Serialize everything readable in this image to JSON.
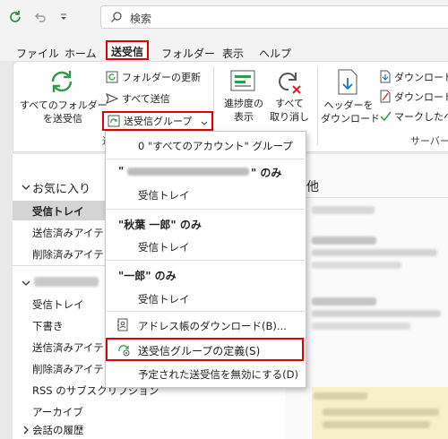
{
  "titlebar": {
    "search_placeholder": "検索"
  },
  "menu": {
    "tabs": [
      "ファイル",
      "ホーム",
      "送受信",
      "フォルダー",
      "表示",
      "ヘルプ"
    ]
  },
  "ribbon": {
    "sendrecv_all_label1": "すべてのフォルダー",
    "sendrecv_all_label2": "を送受信",
    "update_folder": "フォルダーの更新",
    "send_all": "すべて送信",
    "sendrecv_groups": "送受信グループ",
    "progress_label1": "進捗度の",
    "progress_label2": "表示",
    "cancel_all_label1": "すべて",
    "cancel_all_label2": "取り消し",
    "download_headers_label1": "ヘッダーを",
    "download_headers_label2": "ダウンロード",
    "download_item1": "ダウンロード用",
    "download_item2": "ダウンロード用",
    "mark_item": "マークしたヘッ",
    "server_group": "サーバー",
    "sendrecv_group_letter": "送"
  },
  "nav": {
    "favorites": "お気に入り",
    "fav_items": [
      "受信トレイ",
      "送信済みアイテ",
      "削除済みアイテ"
    ],
    "account_items": [
      "受信トレイ",
      "下書き",
      "送信済みアイテ",
      "削除済みアイテ",
      "RSS のサブスクリプション",
      "アーカイブ"
    ],
    "history": "会話の履歴"
  },
  "msg": {
    "header_fragment": "他"
  },
  "dropdown": {
    "all_accounts": "0 \"すべてのアカウント\" グループ",
    "acc1_prefix": "\"",
    "acc1_suffix": "\" のみ",
    "acc1_inbox": "受信トレイ",
    "acc2_title": "\"秋葉 一郎\" のみ",
    "acc2_inbox": "受信トレイ",
    "acc3_title": "\"一郎\" のみ",
    "acc3_inbox": "受信トレイ",
    "download_address_book": "アドレス帳のダウンロード(B)...",
    "define_groups": "送受信グループの定義(S)",
    "disable_scheduled": "予定された送受信を無効にする(D)"
  }
}
